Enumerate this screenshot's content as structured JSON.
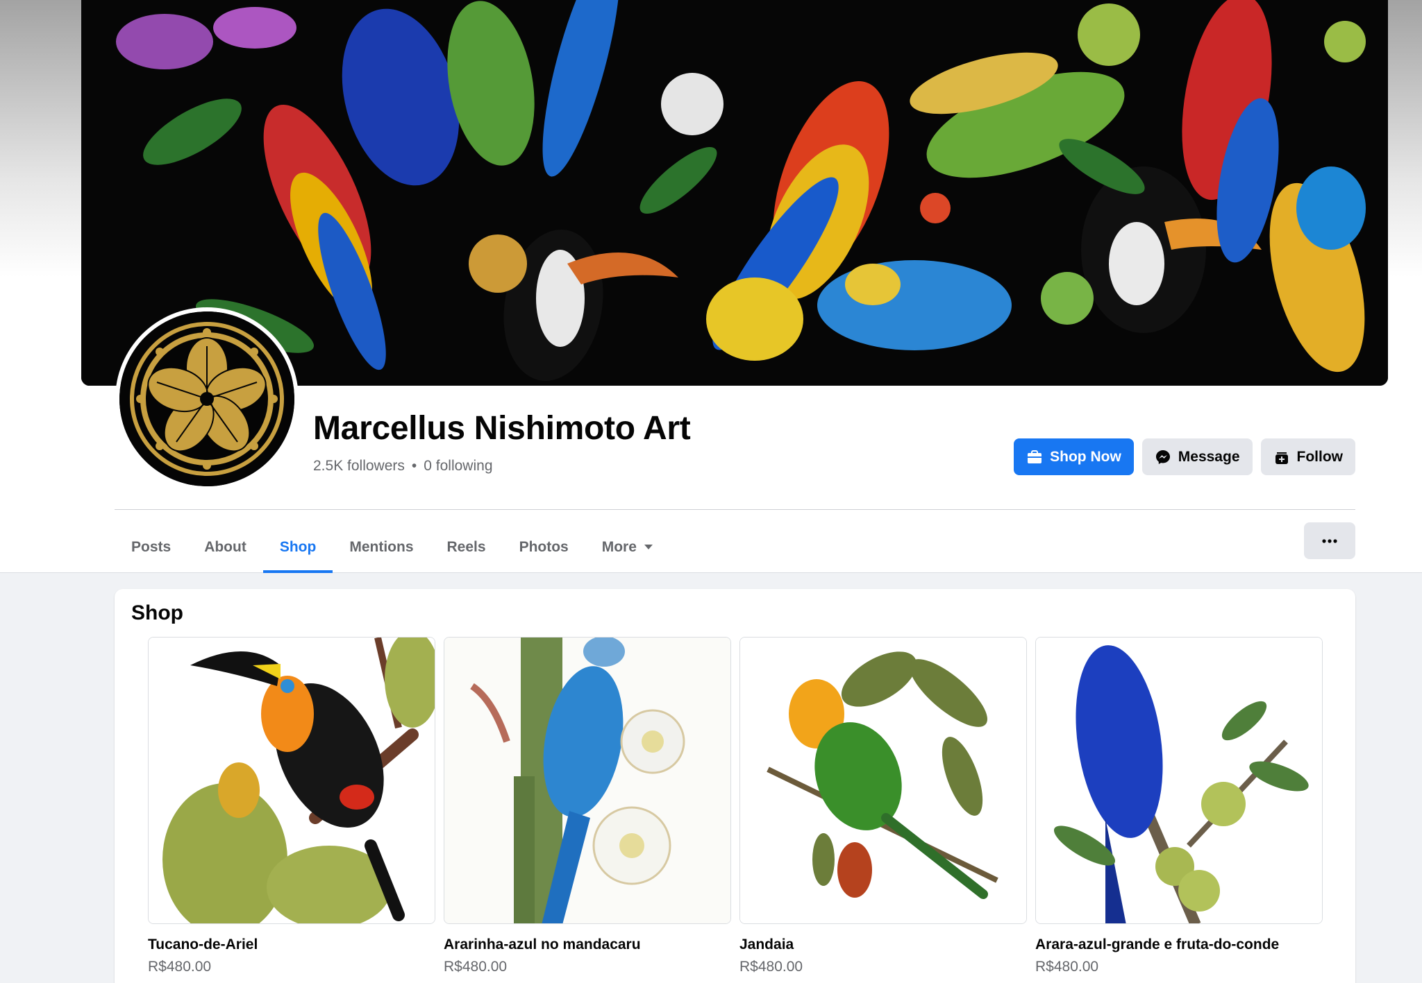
{
  "page": {
    "name": "Marcellus Nishimoto Art",
    "followers": "2.5K followers",
    "separator": "•",
    "following": "0 following"
  },
  "actions": {
    "shop_now": "Shop Now",
    "message": "Message",
    "follow": "Follow"
  },
  "tabs": [
    {
      "label": "Posts",
      "active": false
    },
    {
      "label": "About",
      "active": false
    },
    {
      "label": "Shop",
      "active": true
    },
    {
      "label": "Mentions",
      "active": false
    },
    {
      "label": "Reels",
      "active": false
    },
    {
      "label": "Photos",
      "active": false
    },
    {
      "label": "More",
      "active": false
    }
  ],
  "shop": {
    "title": "Shop",
    "products": [
      {
        "name": "Tucano-de-Ariel",
        "price": "R$480.00"
      },
      {
        "name": "Ararinha-azul no mandacaru",
        "price": "R$480.00"
      },
      {
        "name": "Jandaia",
        "price": "R$480.00"
      },
      {
        "name": "Arara-azul-grande e fruta-do-conde",
        "price": "R$480.00"
      }
    ]
  },
  "colors": {
    "accent": "#1877f2",
    "secondary_button": "#e4e6eb",
    "muted_text": "#65676b",
    "page_background": "#f0f2f5",
    "logo_gold": "#c8a040"
  },
  "icons": {
    "shop_now": "shopping-bag-icon",
    "message": "messenger-icon",
    "follow": "follow-add-icon",
    "more_caret": "caret-down-icon",
    "overflow": "ellipsis-icon"
  }
}
